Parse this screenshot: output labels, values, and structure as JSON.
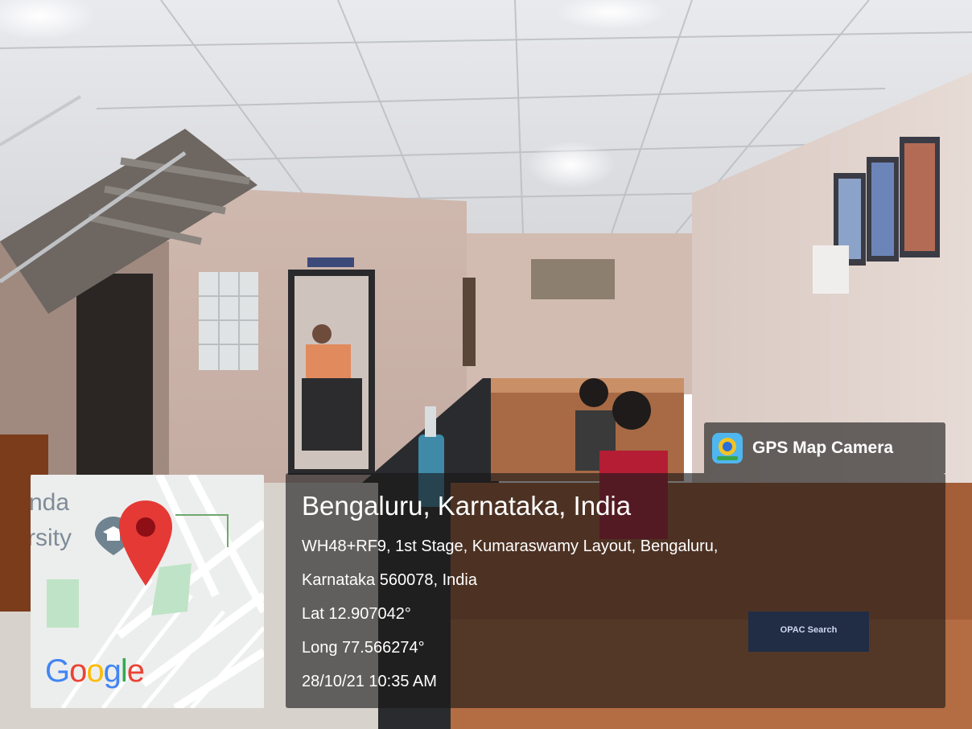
{
  "badge": {
    "app_name": "GPS Map Camera",
    "icon": "gps-map-camera-app-icon"
  },
  "location": {
    "title": "Bengaluru, Karnataka, India",
    "address_line1": "WH48+RF9, 1st Stage, Kumaraswamy Layout, Bengaluru,",
    "address_line2": "Karnataka 560078, India",
    "lat": "Lat 12.907042°",
    "long": "Long 77.566274°",
    "datetime": "28/10/21 10:35 AM"
  },
  "map": {
    "label_top": "nda",
    "label_bottom": "rsity",
    "logo_letters": [
      "G",
      "o",
      "o",
      "g",
      "l",
      "e"
    ],
    "logo_colors": [
      "#4285F4",
      "#EA4335",
      "#FBBC05",
      "#4285F4",
      "#34A853",
      "#EA4335"
    ],
    "icons": [
      "university-icon",
      "map-pin-icon"
    ]
  },
  "scene": {
    "sign_text": "OPAC Search"
  }
}
